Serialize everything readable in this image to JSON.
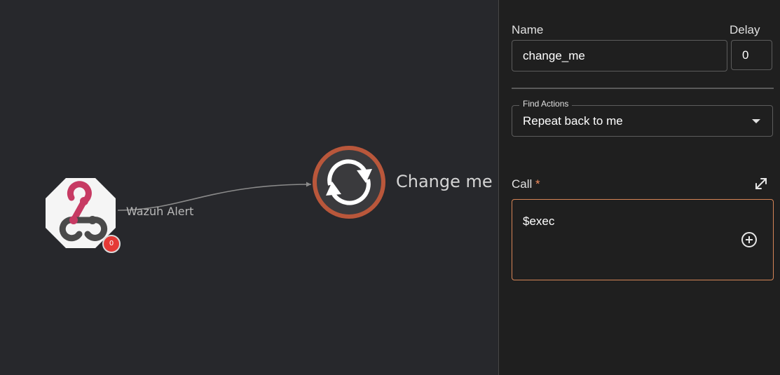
{
  "canvas": {
    "trigger_node": {
      "icon": "webhook-icon",
      "badge_count": "0"
    },
    "edge": {
      "label": "Wazuh Alert"
    },
    "action_node": {
      "icon": "sync-icon",
      "label": "Change me"
    }
  },
  "panel": {
    "name_label": "Name",
    "name_value": "change_me",
    "delay_label": "Delay",
    "delay_value": "0",
    "find_actions_label": "Find Actions",
    "find_actions_value": "Repeat back to me",
    "call_label": "Call",
    "call_required_mark": "*",
    "call_value": "$exec"
  },
  "colors": {
    "canvas_bg": "#27282c",
    "panel_bg": "#1f1f1f",
    "accent": "#d68557",
    "action_ring": "#b9573b",
    "webhook_pink": "#c73a63",
    "badge": "#e53935"
  }
}
